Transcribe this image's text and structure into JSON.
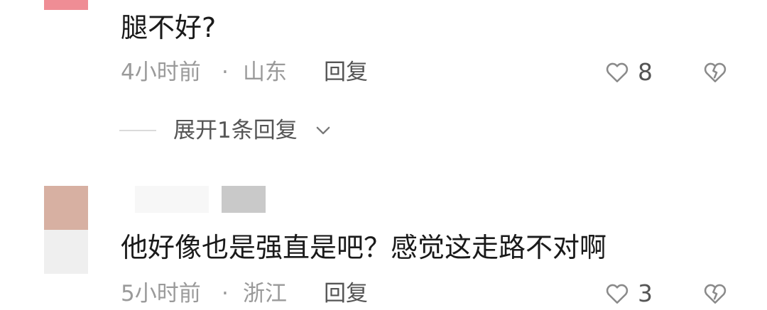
{
  "comments": [
    {
      "text": "腿不好?",
      "time": "4小时前",
      "separator": "·",
      "location": "山东",
      "reply_label": "回复",
      "like_count": "8",
      "expand_replies_label": "展开1条回复"
    },
    {
      "text": "他好像也是强直是吧？感觉这走路不对啊",
      "time": "5小时前",
      "separator": "·",
      "location": "浙江",
      "reply_label": "回复",
      "like_count": "3"
    }
  ],
  "icons": {
    "like": "heart-outline-icon",
    "dislike": "broken-heart-icon",
    "expand": "chevron-down-icon"
  },
  "colors": {
    "text": "#1a1a1a",
    "meta": "#9a9a9a",
    "action": "#555555",
    "icon": "#8a8a8a"
  }
}
